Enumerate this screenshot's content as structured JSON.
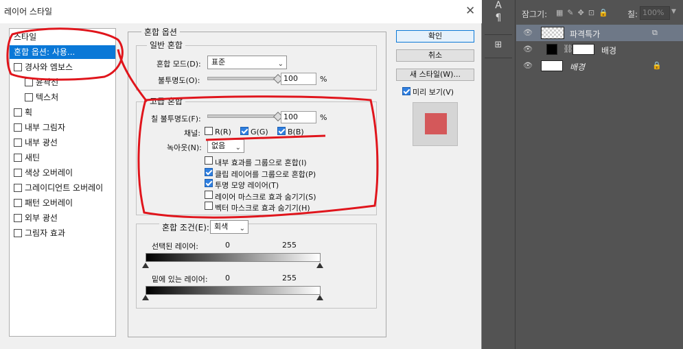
{
  "dialog": {
    "title": "레이어 스타일",
    "close_glyph": "✕",
    "styles": [
      {
        "label": "스타일",
        "checkbox": false
      },
      {
        "label": "혼합 옵션: 사용...",
        "checkbox": false,
        "selected": true
      },
      {
        "label": "경사와 엠보스",
        "checkbox": true,
        "checked": false
      },
      {
        "label": "윤곽선",
        "checkbox": true,
        "checked": false,
        "indent": true
      },
      {
        "label": "텍스처",
        "checkbox": true,
        "checked": false,
        "indent": true
      },
      {
        "label": "획",
        "checkbox": true,
        "checked": false
      },
      {
        "label": "내부 그림자",
        "checkbox": true,
        "checked": false
      },
      {
        "label": "내부 광선",
        "checkbox": true,
        "checked": false
      },
      {
        "label": "새틴",
        "checkbox": true,
        "checked": false
      },
      {
        "label": "색상 오버레이",
        "checkbox": true,
        "checked": false
      },
      {
        "label": "그레이디언트 오버레이",
        "checkbox": true,
        "checked": false
      },
      {
        "label": "패턴 오버레이",
        "checkbox": true,
        "checked": false
      },
      {
        "label": "외부 광선",
        "checkbox": true,
        "checked": false
      },
      {
        "label": "그림자 효과",
        "checkbox": true,
        "checked": false
      }
    ],
    "blend_options": {
      "title": "혼합 옵션",
      "general": {
        "title": "일반 혼합",
        "mode_label": "혼합 모드(D):",
        "mode_value": "표준",
        "opacity_label": "불투명도(O):",
        "opacity_value": "100",
        "opacity_fraction": 1.0,
        "unit": "%"
      },
      "advanced": {
        "title": "고급 혼합",
        "fill_label": "칠 불투명도(F):",
        "fill_value": "100",
        "fill_fraction": 1.0,
        "unit": "%",
        "channels_label": "채널:",
        "channels": [
          {
            "label": "R(R)",
            "checked": false
          },
          {
            "label": "G(G)",
            "checked": true
          },
          {
            "label": "B(B)",
            "checked": true
          }
        ],
        "knockout_label": "녹아웃(N):",
        "knockout_value": "없음",
        "options": [
          {
            "label": "내부 효과를 그룹으로 혼합(I)",
            "checked": false
          },
          {
            "label": "클립 레이어를 그룹으로 혼합(P)",
            "checked": true
          },
          {
            "label": "투명 모양 레이어(T)",
            "checked": true
          },
          {
            "label": "레이어 마스크로 효과 숨기기(S)",
            "checked": false
          },
          {
            "label": "벡터 마스크로 효과 숨기기(H)",
            "checked": false
          }
        ]
      },
      "blend_if": {
        "label": "혼합 조건(E):",
        "value": "회색",
        "this_layer_label": "선택된 레이어:",
        "this_layer_min": "0",
        "this_layer_max": "255",
        "underlying_label": "밑에 있는 레이어:",
        "underlying_min": "0",
        "underlying_max": "255"
      }
    },
    "buttons": {
      "ok": "확인",
      "cancel": "취소",
      "new_style": "새 스타일(W)...",
      "preview_label": "미리 보기(V)",
      "preview_checked": true
    },
    "preview_color": "#d4585a"
  },
  "layers_panel": {
    "lock_label": "잠그기:",
    "fill_label": "칠:",
    "fill_value": "100%",
    "layers": [
      {
        "name": "파격특가",
        "selected": true
      },
      {
        "name": "배경",
        "linked_mask": true
      },
      {
        "name": "배경",
        "italic": true,
        "locked": true
      }
    ]
  },
  "colors": {
    "accent": "#0a78d7",
    "annotation": "#e0151c",
    "ps_bg": "#535353",
    "selected_layer": "#6e7887"
  }
}
